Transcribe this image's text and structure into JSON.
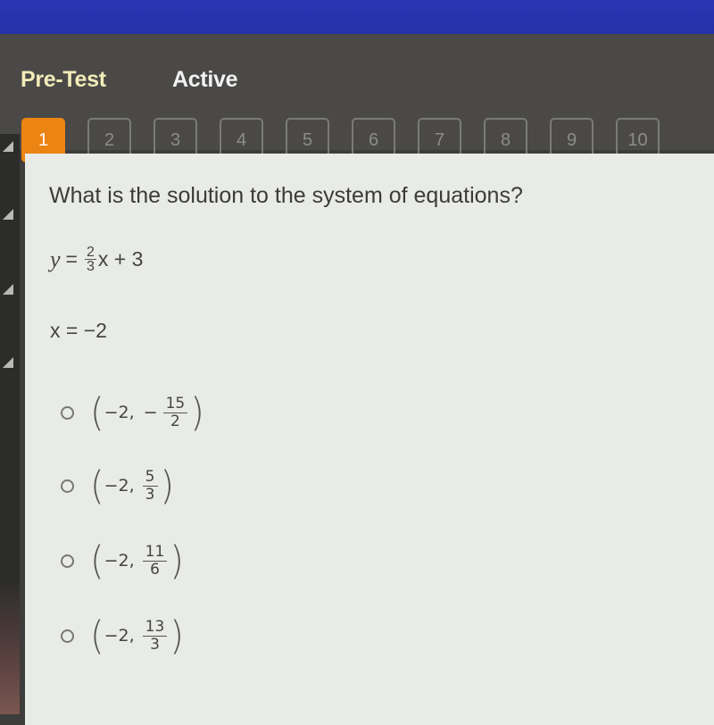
{
  "header": {
    "title": "Pre-Test",
    "status": "Active"
  },
  "question_nav": {
    "current": 1,
    "items": [
      "1",
      "2",
      "3",
      "4",
      "5",
      "6",
      "7",
      "8",
      "9",
      "10"
    ]
  },
  "question": {
    "prompt": "What is the solution to the system of equations?",
    "equation1": {
      "lhs": "y",
      "equals": "=",
      "coef_num": "2",
      "coef_den": "3",
      "rest": "x + 3"
    },
    "equation2": "x = −2"
  },
  "options": [
    {
      "x": "−2,",
      "sign": "−",
      "num": "15",
      "den": "2",
      "selected": false
    },
    {
      "x": "−2,",
      "sign": "",
      "num": "5",
      "den": "3",
      "selected": false
    },
    {
      "x": "−2,",
      "sign": "",
      "num": "11",
      "den": "6",
      "selected": false
    },
    {
      "x": "−2,",
      "sign": "",
      "num": "13",
      "den": "3",
      "selected": false
    }
  ],
  "colors": {
    "topbar": "#2431a8",
    "header_bg": "#4a4947",
    "title": "#f2ecb8",
    "active_question": "#ec8413",
    "panel_bg": "#e9ebe6"
  }
}
